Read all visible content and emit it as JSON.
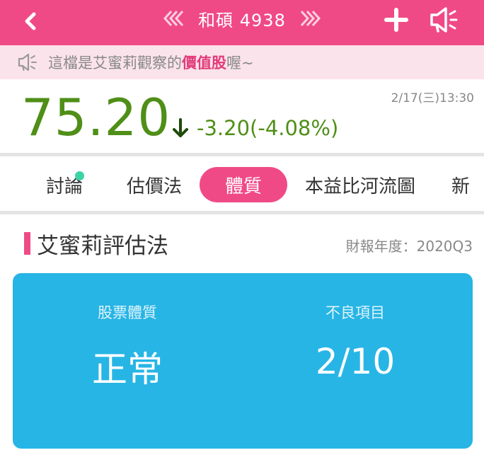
{
  "header": {
    "title": "和碩 4938",
    "icons": [
      "chevron-left-icon",
      "double-chevron-left-icon",
      "double-chevron-right-icon",
      "plus-icon",
      "speaker-icon"
    ]
  },
  "notice": {
    "text_before": "這檔是艾蜜莉觀察的",
    "highlight": "價值股",
    "text_after": "喔~"
  },
  "quote": {
    "price": "75.20",
    "change": "-3.20(-4.08%)",
    "time": "2/17(三)13:30"
  },
  "tabs": [
    {
      "label": "討論",
      "active": false
    },
    {
      "label": "估價法",
      "active": false
    },
    {
      "label": "體質",
      "active": true
    },
    {
      "label": "本益比河流圖",
      "active": false
    },
    {
      "label": "新",
      "active": false
    }
  ],
  "section": {
    "title": "艾蜜莉評估法",
    "report_year": "財報年度：2020Q3"
  },
  "card": {
    "left_label": "股票體質",
    "left_value": "正常",
    "right_label": "不良項目",
    "right_value": "2/10"
  },
  "colors": {
    "brand_pink": "#f04a86",
    "price_green": "#4f8f17",
    "card_blue": "#27b5e5",
    "notice_bg": "#fbe3ec",
    "badge_dot": "#3cd3a6"
  }
}
